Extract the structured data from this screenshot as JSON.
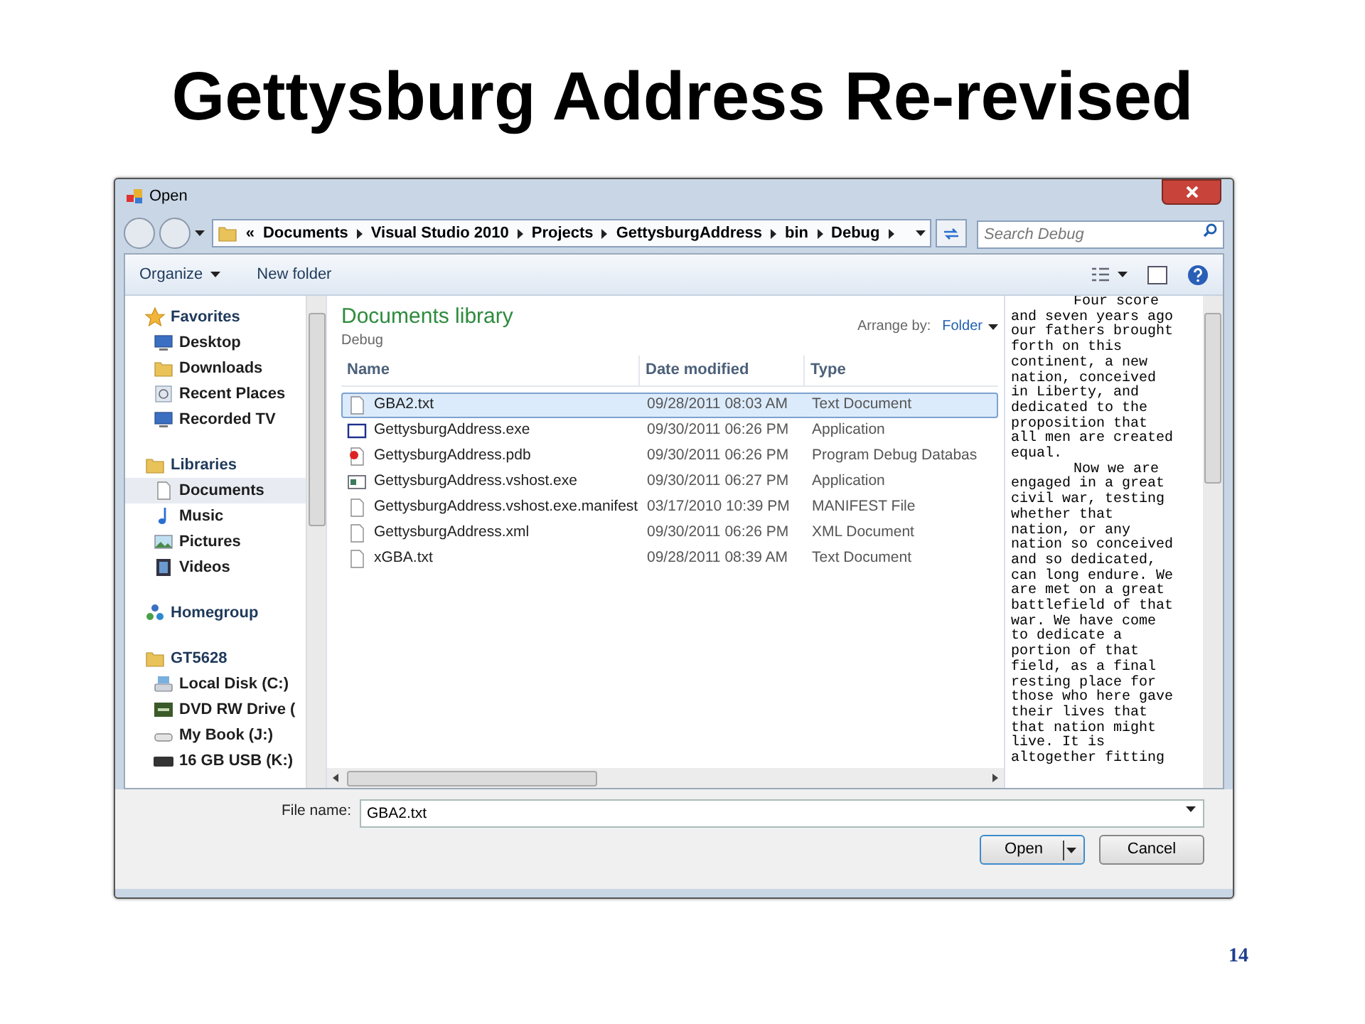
{
  "slide": {
    "title": "Gettysburg Address Re-revised",
    "page_number": "14"
  },
  "window": {
    "title": "Open"
  },
  "address_bar": {
    "overflow": "«",
    "crumbs": [
      "Documents",
      "Visual Studio 2010",
      "Projects",
      "GettysburgAddress",
      "bin",
      "Debug"
    ]
  },
  "search": {
    "placeholder": "Search Debug"
  },
  "toolbar": {
    "organize": "Organize",
    "new_folder": "New folder"
  },
  "nav": [
    {
      "label": "Favorites",
      "children": [
        {
          "label": "Desktop",
          "selected": false
        },
        {
          "label": "Downloads",
          "selected": false
        },
        {
          "label": "Recent Places",
          "selected": false
        },
        {
          "label": "Recorded TV",
          "selected": false
        }
      ]
    },
    {
      "label": "Libraries",
      "children": [
        {
          "label": "Documents",
          "selected": true
        },
        {
          "label": "Music",
          "selected": false
        },
        {
          "label": "Pictures",
          "selected": false
        },
        {
          "label": "Videos",
          "selected": false
        }
      ]
    },
    {
      "label": "Homegroup"
    },
    {
      "label": "GT5628",
      "children": [
        {
          "label": "Local Disk (C:)",
          "selected": false
        },
        {
          "label": "DVD RW Drive (",
          "selected": false
        },
        {
          "label": "My Book (J:)",
          "selected": false
        },
        {
          "label": "16 GB USB (K:)",
          "selected": false
        }
      ]
    }
  ],
  "library": {
    "title": "Documents library",
    "subtitle": "Debug",
    "arrange_label": "Arrange by:",
    "arrange_value": "Folder"
  },
  "columns": [
    "Name",
    "Date modified",
    "Type"
  ],
  "files": [
    {
      "name": "GBA2.txt",
      "date": "09/28/2011 08:03 AM",
      "type": "Text Document",
      "selected": true
    },
    {
      "name": "GettysburgAddress.exe",
      "date": "09/30/2011 06:26 PM",
      "type": "Application",
      "selected": false
    },
    {
      "name": "GettysburgAddress.pdb",
      "date": "09/30/2011 06:26 PM",
      "type": "Program Debug Databas",
      "selected": false
    },
    {
      "name": "GettysburgAddress.vshost.exe",
      "date": "09/30/2011 06:27 PM",
      "type": "Application",
      "selected": false
    },
    {
      "name": "GettysburgAddress.vshost.exe.manifest",
      "date": "03/17/2010 10:39 PM",
      "type": "MANIFEST File",
      "selected": false
    },
    {
      "name": "GettysburgAddress.xml",
      "date": "09/30/2011 06:26 PM",
      "type": "XML Document",
      "selected": false
    },
    {
      "name": "xGBA.txt",
      "date": "09/28/2011 08:39 AM",
      "type": "Text Document",
      "selected": false
    }
  ],
  "preview": [
    {
      "lines": [
        "Four score",
        "and seven years ago",
        "our fathers brought",
        "forth on this",
        "continent, a new",
        "nation, conceived",
        "in Liberty, and",
        "dedicated to the",
        "proposition that",
        "all men are created",
        "equal."
      ]
    },
    {
      "lines": [
        "Now we are",
        "engaged in a great",
        "civil war, testing",
        "whether that",
        "nation, or any",
        "nation so conceived",
        "and so dedicated,",
        "can long endure. We",
        "are met on a great",
        "battlefield of that",
        "war. We have come",
        "to dedicate a",
        "portion of that",
        "field, as a final",
        "resting place for",
        "those who here gave",
        "their lives that",
        "that nation might",
        "live. It is",
        "altogether fitting"
      ]
    }
  ],
  "file_name": {
    "label": "File name:",
    "value": "GBA2.txt"
  },
  "buttons": [
    "Open",
    "Cancel"
  ]
}
